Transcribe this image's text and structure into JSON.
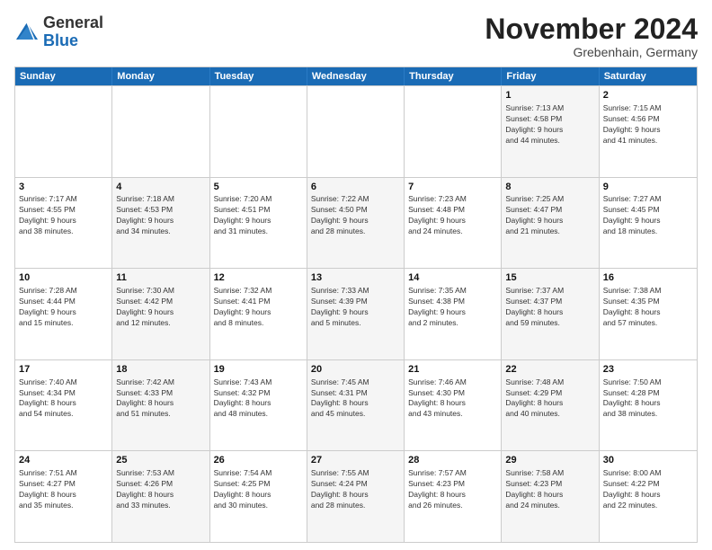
{
  "header": {
    "logo_general": "General",
    "logo_blue": "Blue",
    "month_title": "November 2024",
    "subtitle": "Grebenhain, Germany"
  },
  "calendar": {
    "days_of_week": [
      "Sunday",
      "Monday",
      "Tuesday",
      "Wednesday",
      "Thursday",
      "Friday",
      "Saturday"
    ],
    "weeks": [
      [
        {
          "day": "",
          "info": "",
          "empty": true
        },
        {
          "day": "",
          "info": "",
          "empty": true
        },
        {
          "day": "",
          "info": "",
          "empty": true
        },
        {
          "day": "",
          "info": "",
          "empty": true
        },
        {
          "day": "",
          "info": "",
          "empty": true
        },
        {
          "day": "1",
          "info": "Sunrise: 7:13 AM\nSunset: 4:58 PM\nDaylight: 9 hours\nand 44 minutes."
        },
        {
          "day": "2",
          "info": "Sunrise: 7:15 AM\nSunset: 4:56 PM\nDaylight: 9 hours\nand 41 minutes."
        }
      ],
      [
        {
          "day": "3",
          "info": "Sunrise: 7:17 AM\nSunset: 4:55 PM\nDaylight: 9 hours\nand 38 minutes."
        },
        {
          "day": "4",
          "info": "Sunrise: 7:18 AM\nSunset: 4:53 PM\nDaylight: 9 hours\nand 34 minutes."
        },
        {
          "day": "5",
          "info": "Sunrise: 7:20 AM\nSunset: 4:51 PM\nDaylight: 9 hours\nand 31 minutes."
        },
        {
          "day": "6",
          "info": "Sunrise: 7:22 AM\nSunset: 4:50 PM\nDaylight: 9 hours\nand 28 minutes."
        },
        {
          "day": "7",
          "info": "Sunrise: 7:23 AM\nSunset: 4:48 PM\nDaylight: 9 hours\nand 24 minutes."
        },
        {
          "day": "8",
          "info": "Sunrise: 7:25 AM\nSunset: 4:47 PM\nDaylight: 9 hours\nand 21 minutes."
        },
        {
          "day": "9",
          "info": "Sunrise: 7:27 AM\nSunset: 4:45 PM\nDaylight: 9 hours\nand 18 minutes."
        }
      ],
      [
        {
          "day": "10",
          "info": "Sunrise: 7:28 AM\nSunset: 4:44 PM\nDaylight: 9 hours\nand 15 minutes."
        },
        {
          "day": "11",
          "info": "Sunrise: 7:30 AM\nSunset: 4:42 PM\nDaylight: 9 hours\nand 12 minutes."
        },
        {
          "day": "12",
          "info": "Sunrise: 7:32 AM\nSunset: 4:41 PM\nDaylight: 9 hours\nand 8 minutes."
        },
        {
          "day": "13",
          "info": "Sunrise: 7:33 AM\nSunset: 4:39 PM\nDaylight: 9 hours\nand 5 minutes."
        },
        {
          "day": "14",
          "info": "Sunrise: 7:35 AM\nSunset: 4:38 PM\nDaylight: 9 hours\nand 2 minutes."
        },
        {
          "day": "15",
          "info": "Sunrise: 7:37 AM\nSunset: 4:37 PM\nDaylight: 8 hours\nand 59 minutes."
        },
        {
          "day": "16",
          "info": "Sunrise: 7:38 AM\nSunset: 4:35 PM\nDaylight: 8 hours\nand 57 minutes."
        }
      ],
      [
        {
          "day": "17",
          "info": "Sunrise: 7:40 AM\nSunset: 4:34 PM\nDaylight: 8 hours\nand 54 minutes."
        },
        {
          "day": "18",
          "info": "Sunrise: 7:42 AM\nSunset: 4:33 PM\nDaylight: 8 hours\nand 51 minutes."
        },
        {
          "day": "19",
          "info": "Sunrise: 7:43 AM\nSunset: 4:32 PM\nDaylight: 8 hours\nand 48 minutes."
        },
        {
          "day": "20",
          "info": "Sunrise: 7:45 AM\nSunset: 4:31 PM\nDaylight: 8 hours\nand 45 minutes."
        },
        {
          "day": "21",
          "info": "Sunrise: 7:46 AM\nSunset: 4:30 PM\nDaylight: 8 hours\nand 43 minutes."
        },
        {
          "day": "22",
          "info": "Sunrise: 7:48 AM\nSunset: 4:29 PM\nDaylight: 8 hours\nand 40 minutes."
        },
        {
          "day": "23",
          "info": "Sunrise: 7:50 AM\nSunset: 4:28 PM\nDaylight: 8 hours\nand 38 minutes."
        }
      ],
      [
        {
          "day": "24",
          "info": "Sunrise: 7:51 AM\nSunset: 4:27 PM\nDaylight: 8 hours\nand 35 minutes."
        },
        {
          "day": "25",
          "info": "Sunrise: 7:53 AM\nSunset: 4:26 PM\nDaylight: 8 hours\nand 33 minutes."
        },
        {
          "day": "26",
          "info": "Sunrise: 7:54 AM\nSunset: 4:25 PM\nDaylight: 8 hours\nand 30 minutes."
        },
        {
          "day": "27",
          "info": "Sunrise: 7:55 AM\nSunset: 4:24 PM\nDaylight: 8 hours\nand 28 minutes."
        },
        {
          "day": "28",
          "info": "Sunrise: 7:57 AM\nSunset: 4:23 PM\nDaylight: 8 hours\nand 26 minutes."
        },
        {
          "day": "29",
          "info": "Sunrise: 7:58 AM\nSunset: 4:23 PM\nDaylight: 8 hours\nand 24 minutes."
        },
        {
          "day": "30",
          "info": "Sunrise: 8:00 AM\nSunset: 4:22 PM\nDaylight: 8 hours\nand 22 minutes."
        }
      ]
    ]
  }
}
